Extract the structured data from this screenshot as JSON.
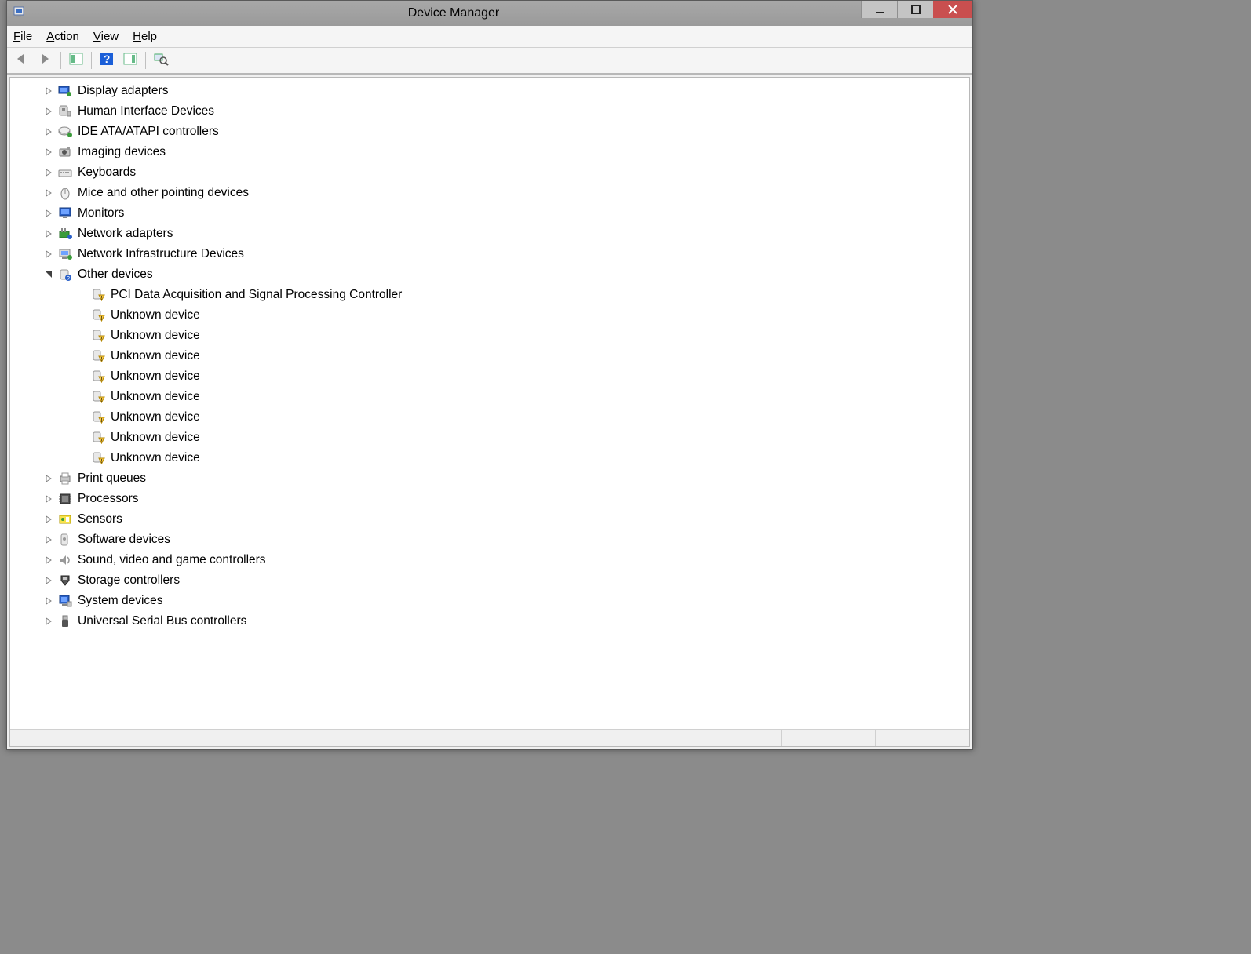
{
  "window": {
    "title": "Device Manager"
  },
  "menu": {
    "file": "File",
    "action": "Action",
    "view": "View",
    "help": "Help"
  },
  "toolbar": {
    "back_icon": "back-arrow",
    "forward_icon": "forward-arrow",
    "show_hidden_icon": "properties-pane",
    "help_icon": "help",
    "action_icon": "action-pane",
    "scan_icon": "scan-hardware"
  },
  "tree": {
    "categories": [
      {
        "label": "Display adapters",
        "icon": "display-adapter",
        "expanded": false,
        "children": []
      },
      {
        "label": "Human Interface Devices",
        "icon": "hid",
        "expanded": false,
        "children": []
      },
      {
        "label": "IDE ATA/ATAPI controllers",
        "icon": "ide",
        "expanded": false,
        "children": []
      },
      {
        "label": "Imaging devices",
        "icon": "imaging",
        "expanded": false,
        "children": []
      },
      {
        "label": "Keyboards",
        "icon": "keyboard",
        "expanded": false,
        "children": []
      },
      {
        "label": "Mice and other pointing devices",
        "icon": "mouse",
        "expanded": false,
        "children": []
      },
      {
        "label": "Monitors",
        "icon": "monitor",
        "expanded": false,
        "children": []
      },
      {
        "label": "Network adapters",
        "icon": "network-adapter",
        "expanded": false,
        "children": []
      },
      {
        "label": "Network Infrastructure Devices",
        "icon": "network-infra",
        "expanded": false,
        "children": []
      },
      {
        "label": "Other devices",
        "icon": "other",
        "expanded": true,
        "children": [
          {
            "label": "PCI Data Acquisition and Signal Processing Controller",
            "icon": "warning-device"
          },
          {
            "label": "Unknown device",
            "icon": "warning-device"
          },
          {
            "label": "Unknown device",
            "icon": "warning-device"
          },
          {
            "label": "Unknown device",
            "icon": "warning-device"
          },
          {
            "label": "Unknown device",
            "icon": "warning-device"
          },
          {
            "label": "Unknown device",
            "icon": "warning-device"
          },
          {
            "label": "Unknown device",
            "icon": "warning-device"
          },
          {
            "label": "Unknown device",
            "icon": "warning-device"
          },
          {
            "label": "Unknown device",
            "icon": "warning-device"
          }
        ]
      },
      {
        "label": "Print queues",
        "icon": "printer",
        "expanded": false,
        "children": []
      },
      {
        "label": "Processors",
        "icon": "processor",
        "expanded": false,
        "children": []
      },
      {
        "label": "Sensors",
        "icon": "sensor",
        "expanded": false,
        "children": []
      },
      {
        "label": "Software devices",
        "icon": "software",
        "expanded": false,
        "children": []
      },
      {
        "label": "Sound, video and game controllers",
        "icon": "sound",
        "expanded": false,
        "children": []
      },
      {
        "label": "Storage controllers",
        "icon": "storage",
        "expanded": false,
        "children": []
      },
      {
        "label": "System devices",
        "icon": "system",
        "expanded": false,
        "children": []
      },
      {
        "label": "Universal Serial Bus controllers",
        "icon": "usb",
        "expanded": false,
        "children": []
      }
    ]
  }
}
